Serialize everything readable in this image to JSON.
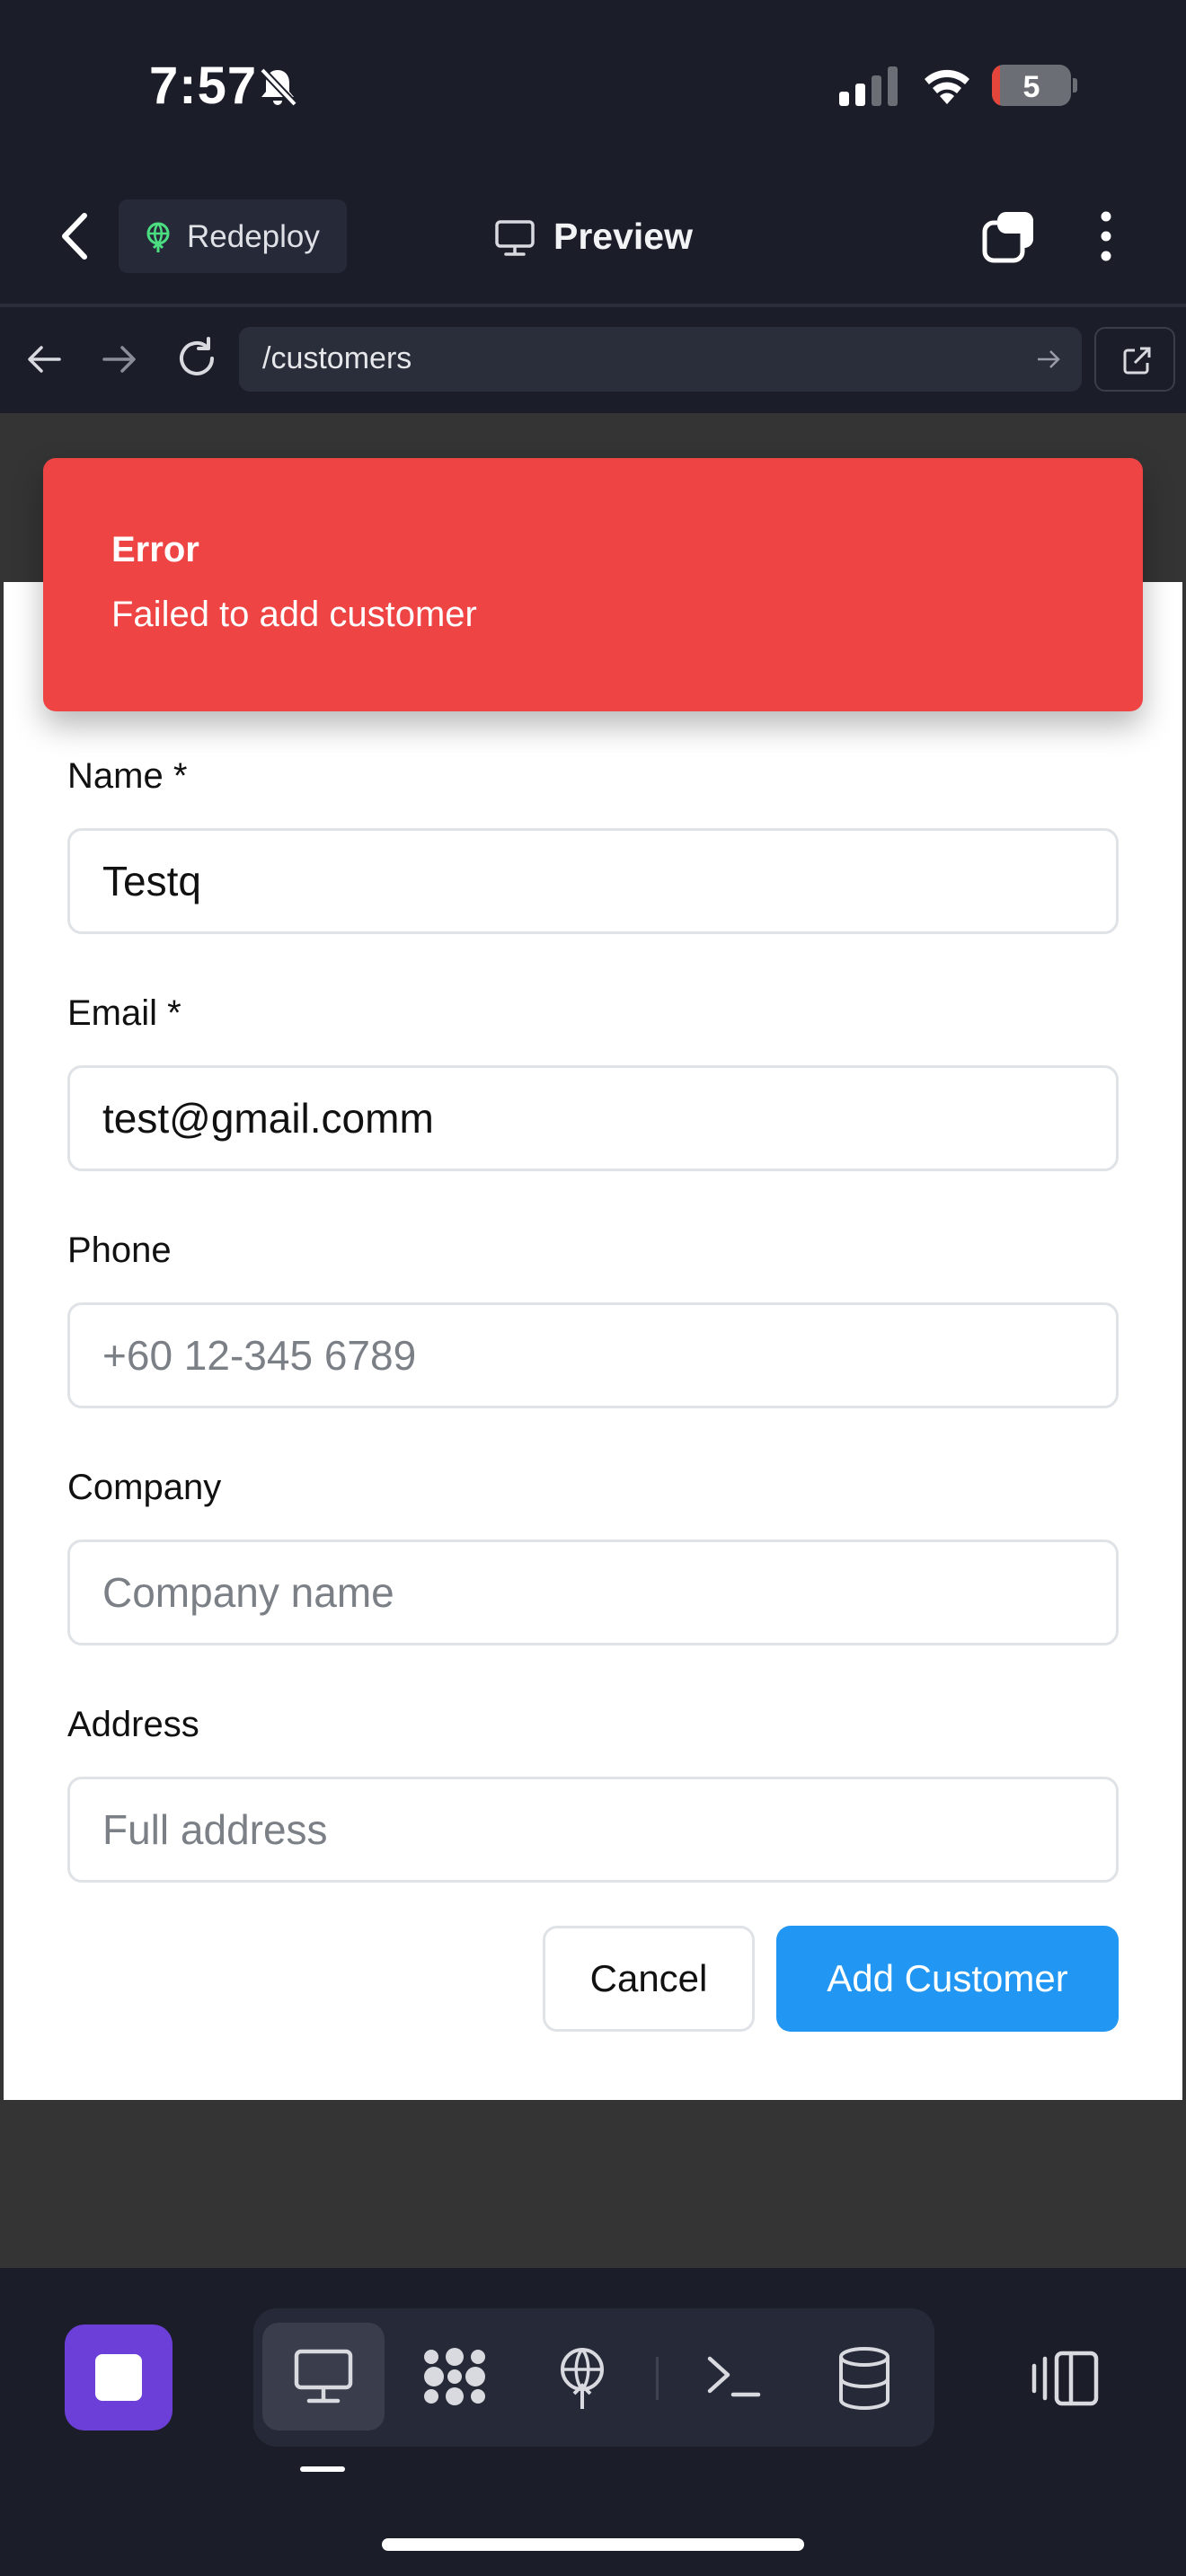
{
  "status_bar": {
    "time": "7:57",
    "battery": "5"
  },
  "header": {
    "redeploy_label": "Redeploy",
    "title": "Preview"
  },
  "url_bar": {
    "path": "/customers"
  },
  "toast": {
    "title": "Error",
    "message": "Failed to add customer"
  },
  "form": {
    "name": {
      "label": "Name *",
      "value": "Testq",
      "placeholder": ""
    },
    "email": {
      "label": "Email *",
      "value": "test@gmail.comm",
      "placeholder": ""
    },
    "phone": {
      "label": "Phone",
      "value": "",
      "placeholder": "+60 12-345 6789"
    },
    "company": {
      "label": "Company",
      "value": "",
      "placeholder": "Company name"
    },
    "address": {
      "label": "Address",
      "value": "",
      "placeholder": "Full address"
    },
    "cancel_label": "Cancel",
    "submit_label": "Add Customer"
  },
  "bottom_toolbar": {
    "tools": [
      "preview-icon",
      "integrations-icon",
      "deploy-icon",
      "terminal-icon",
      "database-icon"
    ],
    "active_tool": "preview-icon"
  },
  "colors": {
    "background": "#1b1d29",
    "toast": "#ef4444",
    "primary_button": "#2196f3",
    "stop_button": "#6d3fd9",
    "redeploy_icon": "#4ade80"
  }
}
